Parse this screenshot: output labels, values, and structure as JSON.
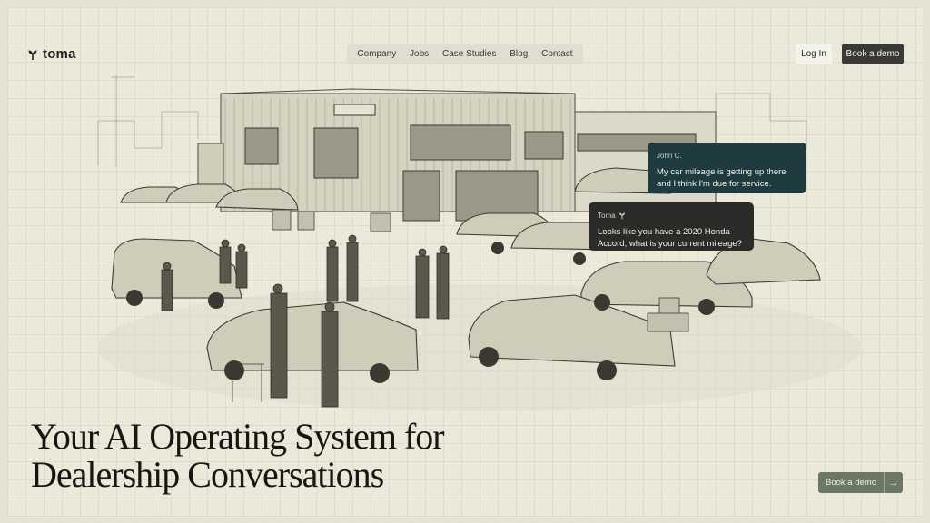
{
  "brand": {
    "name": "toma",
    "logo_icon": "toma-sprout-icon"
  },
  "nav": {
    "items": [
      {
        "label": "Company"
      },
      {
        "label": "Jobs"
      },
      {
        "label": "Case Studies"
      },
      {
        "label": "Blog"
      },
      {
        "label": "Contact"
      }
    ]
  },
  "header": {
    "login_label": "Log In",
    "demo_label": "Book a demo"
  },
  "chat": {
    "user": {
      "name": "John C.",
      "message": "My car mileage is getting up there and I think I'm due for service."
    },
    "bot": {
      "name": "Toma",
      "icon": "toma-sprout-icon",
      "message": "Looks like you have a 2020 Honda Accord, what is your current mileage?"
    }
  },
  "hero": {
    "title_line1": "Your AI Operating System for",
    "title_line2": "Dealership Conversations",
    "cta_label": "Book a demo",
    "cta_icon": "arrow-right-icon"
  },
  "colors": {
    "background": "#ebe9da",
    "user_bubble": "#1f3b3f",
    "bot_bubble": "#2b2b29",
    "cta": "#6c7765",
    "dark_button": "#3a3935"
  }
}
